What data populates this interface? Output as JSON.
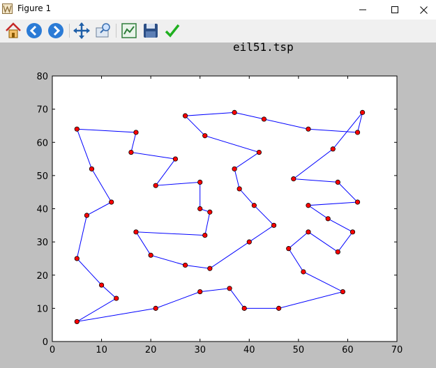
{
  "window": {
    "title": "Figure 1"
  },
  "toolbar": {
    "buttons": [
      {
        "name": "home-icon",
        "tooltip": ""
      },
      {
        "name": "back-icon",
        "tooltip": ""
      },
      {
        "name": "forward-icon",
        "tooltip": ""
      },
      {
        "name": "pan-icon",
        "tooltip": ""
      },
      {
        "name": "zoom-icon",
        "tooltip": ""
      },
      {
        "name": "subplots-icon",
        "tooltip": ""
      },
      {
        "name": "save-icon",
        "tooltip": ""
      },
      {
        "name": "edit-axis-icon",
        "tooltip": ""
      }
    ]
  },
  "plot_title": "eil51.tsp",
  "colors": {
    "route": "#0000ff",
    "node_fill": "#ff0000",
    "node_edge": "#000000",
    "figure_bg": "#bfbfbf",
    "axes_bg": "#ffffff"
  },
  "chart_data": {
    "type": "line",
    "title": "eil51.tsp",
    "xlabel": "",
    "ylabel": "",
    "xlim": [
      0,
      70
    ],
    "ylim": [
      0,
      80
    ],
    "xticks": [
      0,
      10,
      20,
      30,
      40,
      50,
      60,
      70
    ],
    "yticks": [
      0,
      10,
      20,
      30,
      40,
      50,
      60,
      70,
      80
    ],
    "grid": false,
    "series": [
      {
        "markers": true,
        "points": [
          [
            5,
            64
          ],
          [
            17,
            63
          ],
          [
            16,
            57
          ],
          [
            25,
            55
          ],
          [
            21,
            47
          ],
          [
            30,
            48
          ],
          [
            30,
            40
          ],
          [
            32,
            39
          ],
          [
            31,
            32
          ],
          [
            17,
            33
          ],
          [
            20,
            26
          ],
          [
            27,
            23
          ],
          [
            32,
            22
          ],
          [
            40,
            30
          ],
          [
            45,
            35
          ],
          [
            41,
            41
          ],
          [
            38,
            46
          ],
          [
            37,
            52
          ],
          [
            42,
            57
          ],
          [
            31,
            62
          ],
          [
            27,
            68
          ],
          [
            37,
            69
          ],
          [
            43,
            67
          ],
          [
            52,
            64
          ],
          [
            62,
            63
          ],
          [
            63,
            69
          ],
          [
            57,
            58
          ],
          [
            49,
            49
          ],
          [
            58,
            48
          ],
          [
            62,
            42
          ],
          [
            52,
            41
          ],
          [
            56,
            37
          ],
          [
            61,
            33
          ],
          [
            58,
            27
          ],
          [
            52,
            33
          ],
          [
            48,
            28
          ],
          [
            51,
            21
          ],
          [
            59,
            15
          ],
          [
            46,
            10
          ],
          [
            39,
            10
          ],
          [
            36,
            16
          ],
          [
            30,
            15
          ],
          [
            21,
            10
          ],
          [
            5,
            6
          ],
          [
            13,
            13
          ],
          [
            10,
            17
          ],
          [
            5,
            25
          ],
          [
            7,
            38
          ],
          [
            12,
            42
          ],
          [
            8,
            52
          ],
          [
            5,
            64
          ]
        ]
      }
    ]
  }
}
